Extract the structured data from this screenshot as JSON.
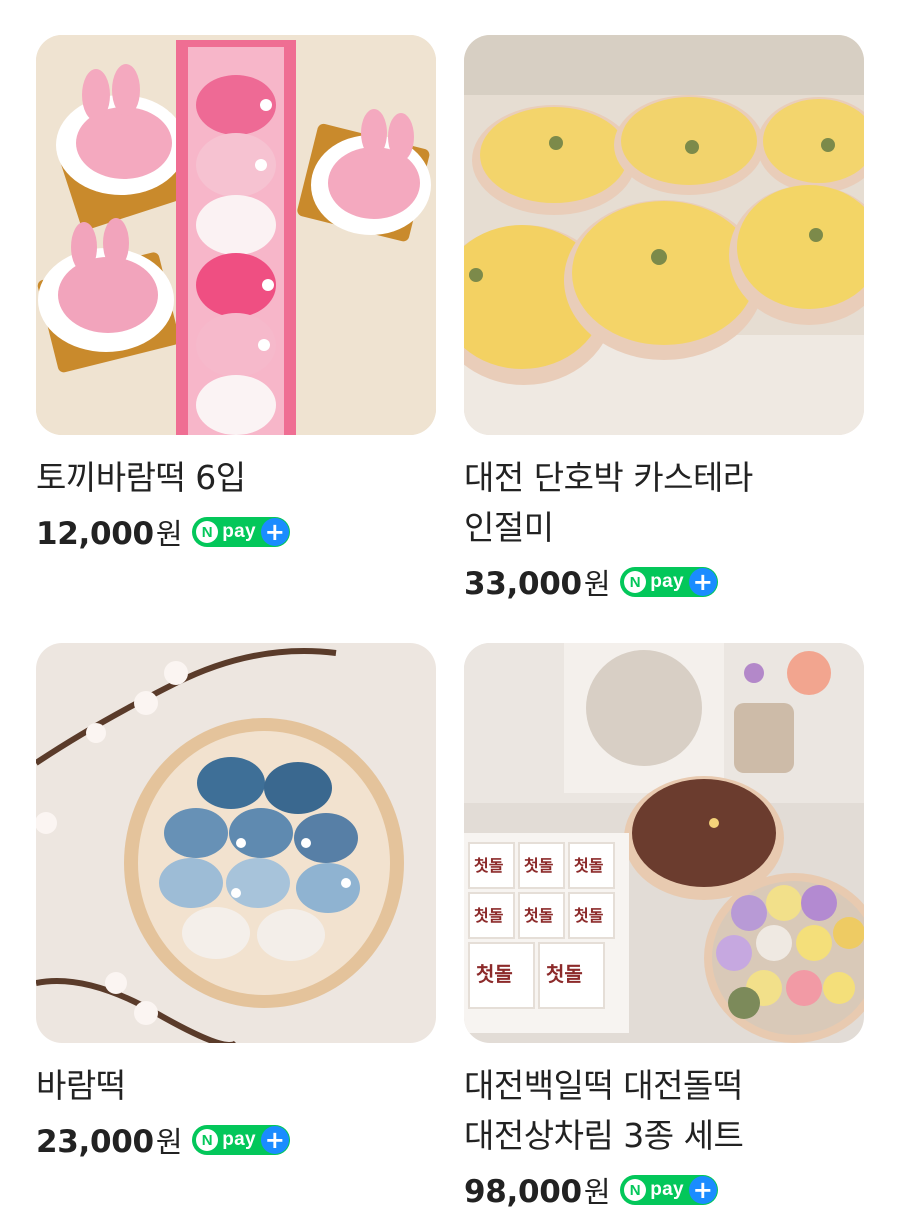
{
  "products": [
    {
      "name": "토끼바람떡 6입",
      "price": "12,000",
      "currency": "원",
      "badge": {
        "n": "N",
        "text": "pay",
        "plus": "+"
      },
      "image": "pink-rabbit-rice-cakes"
    },
    {
      "name": "대전 단호박 카스테라 인절미",
      "price": "33,000",
      "currency": "원",
      "badge": {
        "n": "N",
        "text": "pay",
        "plus": "+"
      },
      "image": "pumpkin-castella-injeolmi"
    },
    {
      "name": "바람떡",
      "price": "23,000",
      "currency": "원",
      "badge": {
        "n": "N",
        "text": "pay",
        "plus": "+"
      },
      "image": "blue-rabbit-rice-cakes"
    },
    {
      "name": "대전백일떡 대전돌떡 대전상차림 3종 세트",
      "price": "98,000",
      "currency": "원",
      "badge": {
        "n": "N",
        "text": "pay",
        "plus": "+"
      },
      "image": "first-birthday-rice-cake-set"
    }
  ],
  "image_labels": {
    "dol_text": "첫돌"
  },
  "colors": {
    "npay_green": "#03c75a",
    "npay_plus_blue": "#1a8cff",
    "text": "#222222"
  }
}
